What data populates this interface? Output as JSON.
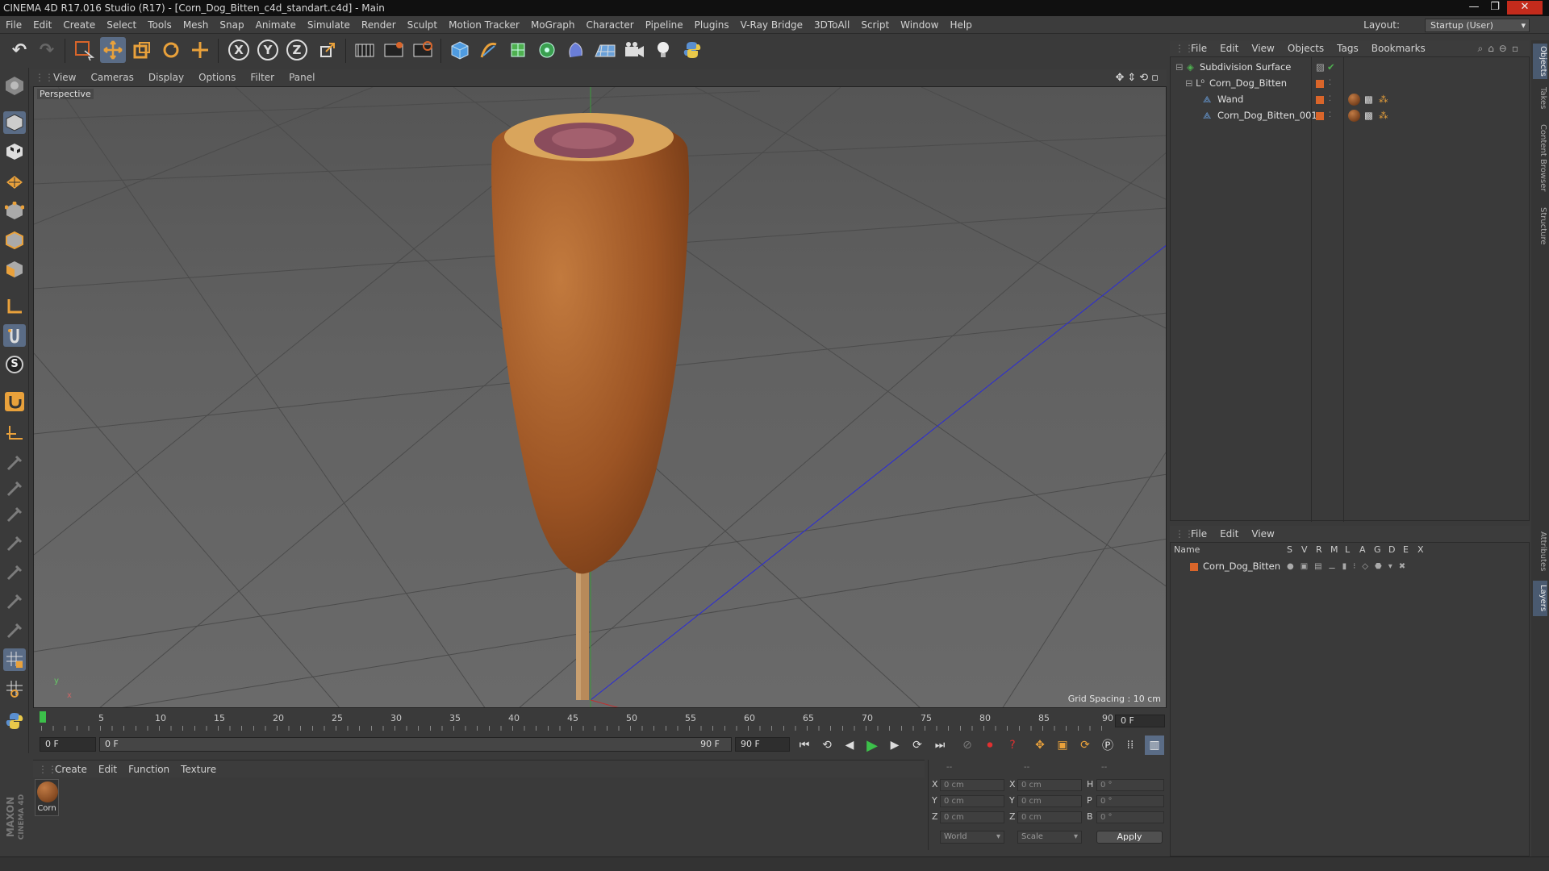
{
  "window": {
    "title": "CINEMA 4D R17.016 Studio (R17) - [Corn_Dog_Bitten_c4d_standart.c4d] - Main"
  },
  "menubar": [
    "File",
    "Edit",
    "Create",
    "Select",
    "Tools",
    "Mesh",
    "Snap",
    "Animate",
    "Simulate",
    "Render",
    "Sculpt",
    "Motion Tracker",
    "MoGraph",
    "Character",
    "Pipeline",
    "Plugins",
    "V-Ray Bridge",
    "3DToAll",
    "Script",
    "Window",
    "Help"
  ],
  "layout": {
    "label": "Layout:",
    "value": "Startup (User)"
  },
  "toolbar": {
    "axis_x": "X",
    "axis_y": "Y",
    "axis_z": "Z"
  },
  "viewport": {
    "menu": [
      "View",
      "Cameras",
      "Display",
      "Options",
      "Filter",
      "Panel"
    ],
    "camera_label": "Perspective",
    "grid_spacing": "Grid Spacing : 10 cm",
    "axis_y": "y",
    "axis_x": "x"
  },
  "timeline": {
    "ticks": [
      "0",
      "5",
      "10",
      "15",
      "20",
      "25",
      "30",
      "35",
      "40",
      "45",
      "50",
      "55",
      "60",
      "65",
      "70",
      "75",
      "80",
      "85",
      "90"
    ],
    "current_frame": "0 F"
  },
  "transport": {
    "start_field": "0 F",
    "range_start": "0 F",
    "range_end": "90 F",
    "end_field": "90 F"
  },
  "materials": {
    "menu": [
      "Create",
      "Edit",
      "Function",
      "Texture"
    ],
    "items": [
      {
        "name": "Corn"
      }
    ]
  },
  "coordinates": {
    "header": [
      "--",
      "--",
      "--"
    ],
    "rows": [
      {
        "l1": "X",
        "v1": "0 cm",
        "l2": "X",
        "v2": "0 cm",
        "l3": "H",
        "v3": "0 °"
      },
      {
        "l1": "Y",
        "v1": "0 cm",
        "l2": "Y",
        "v2": "0 cm",
        "l3": "P",
        "v3": "0 °"
      },
      {
        "l1": "Z",
        "v1": "0 cm",
        "l2": "Z",
        "v2": "0 cm",
        "l3": "B",
        "v3": "0 °"
      }
    ],
    "world_select": "World",
    "scale_select": "Scale",
    "apply": "Apply"
  },
  "objects_panel": {
    "menu": [
      "File",
      "Edit",
      "View",
      "Objects",
      "Tags",
      "Bookmarks"
    ],
    "items": [
      {
        "name": "Subdivision Surface"
      },
      {
        "name": "Corn_Dog_Bitten"
      },
      {
        "name": "Wand"
      },
      {
        "name": "Corn_Dog_Bitten_001"
      }
    ]
  },
  "layers_panel": {
    "menu": [
      "File",
      "Edit",
      "View"
    ],
    "columns": [
      "Name",
      "S",
      "V",
      "R",
      "M",
      "L",
      "A",
      "G",
      "D",
      "E",
      "X"
    ],
    "items": [
      {
        "name": "Corn_Dog_Bitten"
      }
    ]
  },
  "side_tabs": [
    "Objects",
    "Takes",
    "Content Browser",
    "Structure",
    "Attributes",
    "Layers"
  ],
  "brand": {
    "maxon": "MAXON",
    "c4d": "CINEMA 4D"
  },
  "colors": {
    "accent_orange": "#e9a13b",
    "layer_orange": "#d9652a",
    "corn_dog": "#a65a22"
  }
}
